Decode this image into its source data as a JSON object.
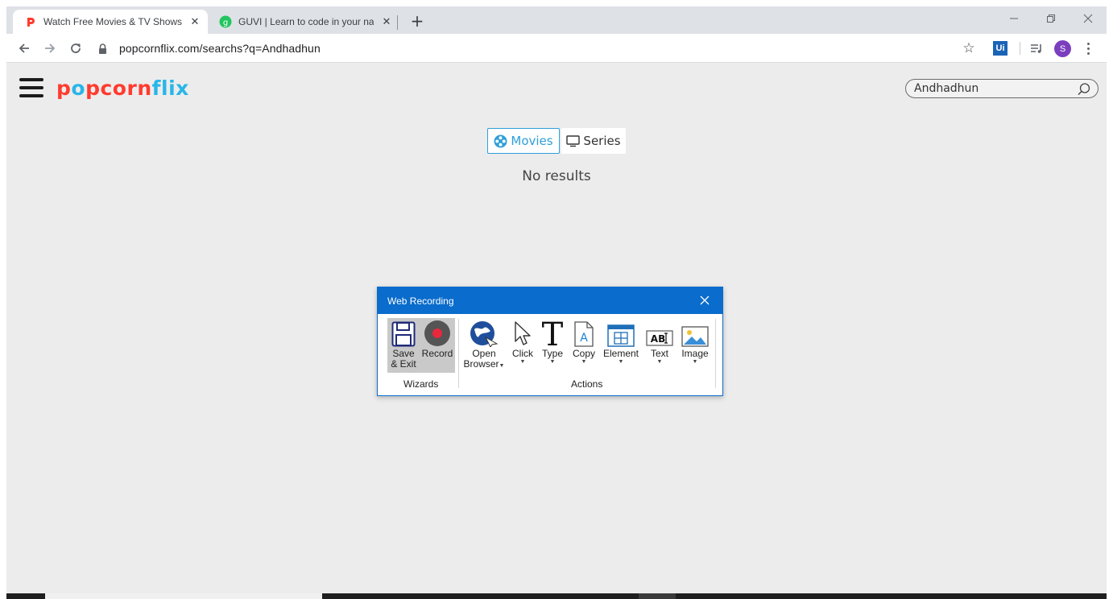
{
  "browser": {
    "tabs": [
      {
        "title": "Watch Free Movies & TV Shows (",
        "active": true,
        "favicon": "popcornflix-favicon"
      },
      {
        "title": "GUVI | Learn to code in your nati",
        "active": false,
        "favicon": "guvi-favicon"
      }
    ],
    "url": "popcornflix.com/searchs?q=Andhadhun",
    "extension_label": "Ui",
    "profile_initial": "S",
    "colors": {
      "profile": "#7b3fbe",
      "extension": "#1a64b7"
    }
  },
  "site": {
    "logo_text": "popcornflix",
    "search_value": "Andhadhun",
    "tabs": [
      {
        "label": "Movies",
        "icon": "film-reel-icon",
        "selected": true
      },
      {
        "label": "Series",
        "icon": "monitor-icon",
        "selected": false
      }
    ],
    "empty_message": "No results",
    "colors": {
      "brand_red": "#ff3b2f",
      "brand_cyan": "#29b6e8",
      "accent": "#2e9fd8"
    }
  },
  "recording_dialog": {
    "title": "Web Recording",
    "wizards_label": "Wizards",
    "actions_label": "Actions",
    "buttons": {
      "save_exit": "Save\n& Exit",
      "record": "Record",
      "open_browser": "Open\nBrowser",
      "click": "Click",
      "type": "Type",
      "copy": "Copy",
      "element": "Element",
      "text": "Text",
      "image": "Image"
    },
    "colors": {
      "title_bar": "#0a6ccc",
      "record_dot": "#e8283c"
    }
  }
}
